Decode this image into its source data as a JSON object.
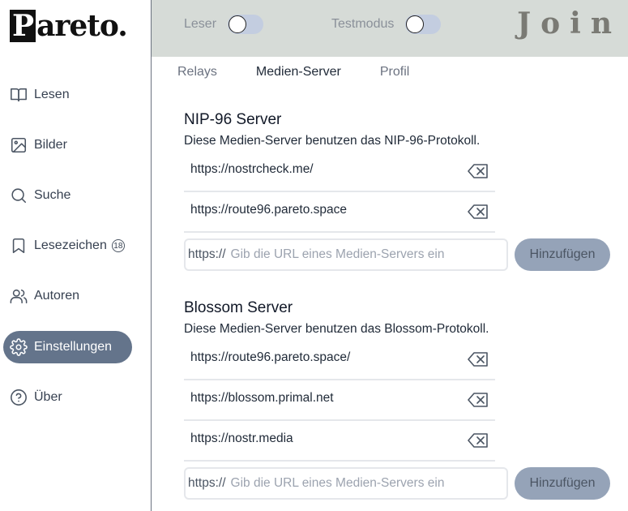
{
  "logo": {
    "first": "P",
    "rest": "areto."
  },
  "nav": [
    {
      "label": "Lesen",
      "icon": "book-icon"
    },
    {
      "label": "Bilder",
      "icon": "image-icon"
    },
    {
      "label": "Suche",
      "icon": "search-icon"
    },
    {
      "label": "Lesezeichen",
      "icon": "bookmark-icon",
      "badge": "18"
    },
    {
      "label": "Autoren",
      "icon": "users-icon"
    },
    {
      "label": "Einstellungen",
      "icon": "gear-icon",
      "active": true
    },
    {
      "label": "Über",
      "icon": "help-circle-icon"
    }
  ],
  "topbar": {
    "reader_label": "Leser",
    "test_label": "Testmodus",
    "join_text": "Join"
  },
  "tabs": [
    {
      "label": "Relays"
    },
    {
      "label": "Medien-Server",
      "active": true
    },
    {
      "label": "Profil"
    }
  ],
  "nip96": {
    "title": "NIP-96 Server",
    "description": "Diese Medien-Server benutzen das NIP-96-Protokoll.",
    "servers": [
      "https://nostrcheck.me/",
      "https://route96.pareto.space"
    ],
    "input_prefix": "https://",
    "input_placeholder": "Gib die URL eines Medien-Servers ein",
    "add_label": "Hinzufügen"
  },
  "blossom": {
    "title": "Blossom Server",
    "description": "Diese Medien-Server benutzen das Blossom-Protokoll.",
    "servers": [
      "https://route96.pareto.space/",
      "https://blossom.primal.net",
      "https://nostr.media"
    ],
    "input_prefix": "https://",
    "input_placeholder": "Gib die URL eines Medien-Servers ein",
    "add_label": "Hinzufügen"
  },
  "colors": {
    "active_nav": "#64748b",
    "topbar_bg": "#d6dbd7",
    "toggle_track": "#c3cde0",
    "add_button": "#95a3b8"
  }
}
